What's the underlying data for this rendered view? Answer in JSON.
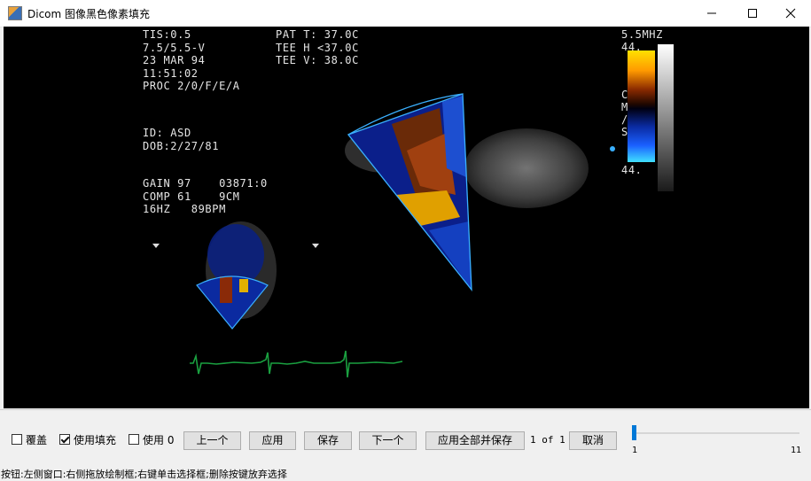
{
  "window": {
    "title": "Dicom 图像黑色像素填充",
    "icon": "java-cup-icon",
    "controls": [
      "minimize-icon",
      "maximize-icon",
      "close-icon"
    ]
  },
  "overlay": {
    "params_left": "TIS:0.5\n7.5/5.5-V\n23 MAR 94\n11:51:02\nPROC 2/0/F/E/A",
    "params_right": "PAT T: 37.0C\nTEE H <37.0C\nTEE V: 38.0C",
    "patient": "ID: ASD\nDOB:2/27/81",
    "gain": "GAIN 97    03871:0\nCOMP 61    9CM\n16HZ   89BPM",
    "freq": "5.5MHZ",
    "scale_top": "44.",
    "scale_unit": "C\nM\n/\nS",
    "scale_bottom": "44."
  },
  "toolbar": {
    "overlay_label": "覆盖",
    "overlay_checked": false,
    "fill_label": "使用填充",
    "fill_checked": true,
    "use_label": "使用 0",
    "use_checked": false,
    "prev_label": "上一个",
    "apply_label": "应用",
    "save_label": "保存",
    "next_label": "下一个",
    "apply_all_label": "应用全部并保存",
    "page_info": "1 of 1",
    "cancel_label": "取消",
    "slider": {
      "min": "1",
      "max": "11",
      "value": 1
    }
  },
  "status": {
    "hint": "按钮:左侧窗口:右侧拖放绘制框;右键单击选择框;删除按键放弃选择"
  }
}
